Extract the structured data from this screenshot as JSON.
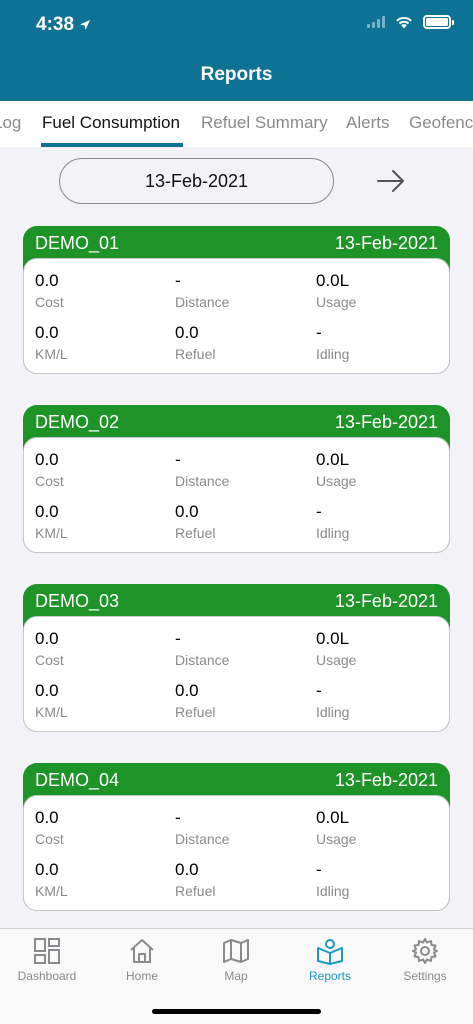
{
  "status": {
    "time": "4:38"
  },
  "header": {
    "title": "Reports"
  },
  "tabs": [
    {
      "label": "Log"
    },
    {
      "label": "Fuel Consumption"
    },
    {
      "label": "Refuel Summary"
    },
    {
      "label": "Alerts"
    },
    {
      "label": "Geofenc"
    }
  ],
  "date_selector": {
    "date": "13-Feb-2021"
  },
  "colors": {
    "header": "#0e7294",
    "card_header": "#1e9428",
    "active_nav": "#1a9ac2"
  },
  "cards": [
    {
      "name": "DEMO_01",
      "date": "13-Feb-2021",
      "cost": "0.0",
      "cost_label": "Cost",
      "distance": "-",
      "distance_label": "Distance",
      "usage": "0.0L",
      "usage_label": "Usage",
      "kml": "0.0",
      "kml_label": "KM/L",
      "refuel": "0.0",
      "refuel_label": "Refuel",
      "idling": "-",
      "idling_label": "Idling"
    },
    {
      "name": "DEMO_02",
      "date": "13-Feb-2021",
      "cost": "0.0",
      "cost_label": "Cost",
      "distance": "-",
      "distance_label": "Distance",
      "usage": "0.0L",
      "usage_label": "Usage",
      "kml": "0.0",
      "kml_label": "KM/L",
      "refuel": "0.0",
      "refuel_label": "Refuel",
      "idling": "-",
      "idling_label": "Idling"
    },
    {
      "name": "DEMO_03",
      "date": "13-Feb-2021",
      "cost": "0.0",
      "cost_label": "Cost",
      "distance": "-",
      "distance_label": "Distance",
      "usage": "0.0L",
      "usage_label": "Usage",
      "kml": "0.0",
      "kml_label": "KM/L",
      "refuel": "0.0",
      "refuel_label": "Refuel",
      "idling": "-",
      "idling_label": "Idling"
    },
    {
      "name": "DEMO_04",
      "date": "13-Feb-2021",
      "cost": "0.0",
      "cost_label": "Cost",
      "distance": "-",
      "distance_label": "Distance",
      "usage": "0.0L",
      "usage_label": "Usage",
      "kml": "0.0",
      "kml_label": "KM/L",
      "refuel": "0.0",
      "refuel_label": "Refuel",
      "idling": "-",
      "idling_label": "Idling"
    }
  ],
  "bottom_nav": [
    {
      "label": "Dashboard",
      "icon": "dashboard-icon"
    },
    {
      "label": "Home",
      "icon": "home-icon"
    },
    {
      "label": "Map",
      "icon": "map-icon"
    },
    {
      "label": "Reports",
      "icon": "reports-icon"
    },
    {
      "label": "Settings",
      "icon": "gear-icon"
    }
  ]
}
